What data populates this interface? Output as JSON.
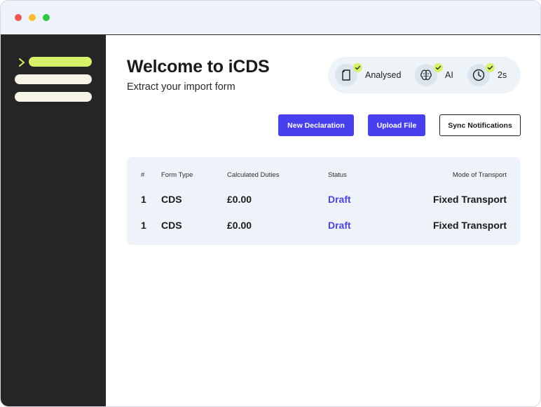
{
  "window": {
    "controls": [
      "close",
      "minimize",
      "maximize"
    ]
  },
  "sidebar": {
    "items": [
      {
        "state": "active",
        "icon": "chevron-right-icon"
      },
      {
        "state": "inactive"
      },
      {
        "state": "inactive"
      }
    ],
    "colors": {
      "background": "#252525",
      "active": "#d6f26a",
      "inactive": "#f6f4e6"
    }
  },
  "header": {
    "title": "Welcome to iCDS",
    "subtitle": "Extract your import form"
  },
  "status": {
    "items": [
      {
        "icon": "document-icon",
        "label": "Analysed",
        "checked": true
      },
      {
        "icon": "brain-icon",
        "label": "AI",
        "checked": true
      },
      {
        "icon": "clock-icon",
        "label": "2s",
        "checked": true
      }
    ]
  },
  "actions": {
    "new_declaration": "New Declaration",
    "upload_file": "Upload File",
    "sync_notifications": "Sync Notifications"
  },
  "table": {
    "headers": [
      "#",
      "Form Type",
      "Calculated Duties",
      "Status",
      "Mode of Transport"
    ],
    "rows": [
      {
        "num": "1",
        "form_type": "CDS",
        "duties": "£0.00",
        "status": "Draft",
        "transport": "Fixed Transport"
      },
      {
        "num": "1",
        "form_type": "CDS",
        "duties": "£0.00",
        "status": "Draft",
        "transport": "Fixed Transport"
      }
    ]
  },
  "colors": {
    "accent": "#4840ee",
    "status_link": "#4a43e3",
    "check": "#d6f26a",
    "titlebar": "#eef3fb"
  }
}
